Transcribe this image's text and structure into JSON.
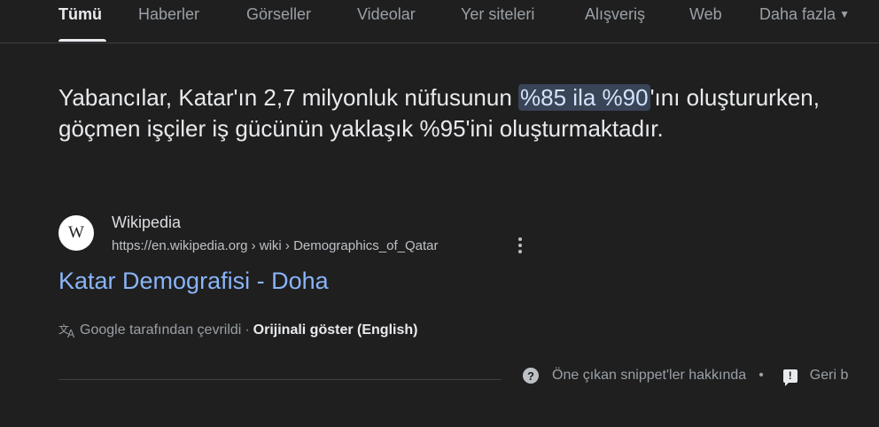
{
  "tabs": [
    {
      "label": "Tümü",
      "active": true
    },
    {
      "label": "Haberler"
    },
    {
      "label": "Görseller"
    },
    {
      "label": "Videolar"
    },
    {
      "label": "Yer siteleri"
    },
    {
      "label": "Alışveriş"
    },
    {
      "label": "Web"
    },
    {
      "label": "Daha fazla"
    }
  ],
  "snippet": {
    "before": "Yabancılar, Katar'ın 2,7 milyonluk nüfusunun ",
    "highlight": "%85 ila %90",
    "after": "'ını oluştururken, göçmen işçiler iş gücünün yaklaşık %95'ini oluşturmaktadır."
  },
  "source": {
    "logo_letter": "W",
    "name": "Wikipedia",
    "url": "https://en.wikipedia.org › wiki › Demographics_of_Qatar"
  },
  "result": {
    "title": "Katar Demografisi - Doha"
  },
  "translation": {
    "note": "Google tarafından çevrildi",
    "separator": "·",
    "show_original": "Orijinali göster (English)"
  },
  "footer": {
    "about_snippets": "Öne çıkan snippet'ler hakkında",
    "separator": "•",
    "feedback": "Geri b"
  },
  "colors": {
    "background": "#1f1f1f",
    "link": "#8ab4f8",
    "highlight_bg": "#394457"
  }
}
